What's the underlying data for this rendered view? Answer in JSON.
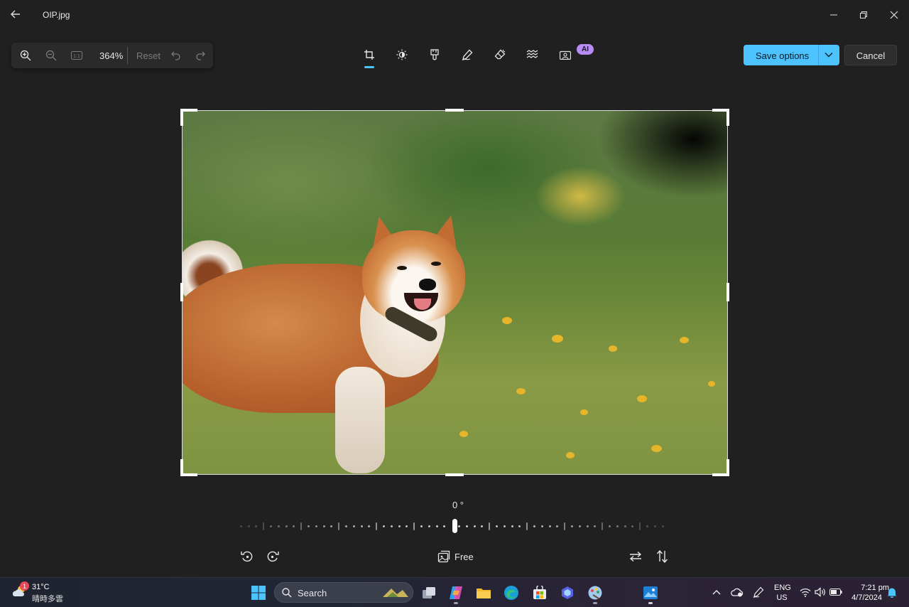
{
  "window": {
    "title": "OIP.jpg",
    "icons": {
      "back": "back-arrow-icon",
      "minimize": "minimize-icon",
      "restore": "restore-icon",
      "close": "close-icon"
    }
  },
  "zoom_toolbar": {
    "zoom_percent": "364%",
    "reset_label": "Reset",
    "icons": [
      "zoom-in-icon",
      "zoom-out-icon",
      "actual-size-icon",
      "undo-icon",
      "redo-icon"
    ]
  },
  "edit_tools": {
    "active": "crop",
    "items": [
      "crop",
      "adjustment",
      "filter",
      "markup",
      "erase",
      "blur-background",
      "remove-background"
    ],
    "ai_badge": "AI"
  },
  "actions": {
    "save_label": "Save options",
    "cancel_label": "Cancel"
  },
  "straighten": {
    "angle_label": "0 °",
    "angle_value": 0
  },
  "crop_controls": {
    "aspect_label": "Free"
  },
  "taskbar": {
    "weather": {
      "temp": "31°C",
      "desc": "晴時多雲",
      "badge": "1"
    },
    "search_placeholder": "Search",
    "apps": [
      "windows-start",
      "task-view",
      "copilot",
      "file-explorer",
      "edge",
      "microsoft-store",
      "copilot-pro",
      "paint",
      "photos"
    ],
    "language": {
      "line1": "ENG",
      "line2": "US"
    },
    "clock": {
      "time": "7:21 pm",
      "date": "4/7/2024"
    }
  },
  "colors": {
    "accent": "#4cc2ff",
    "background": "#202020",
    "ai_badge": "#b88cf6"
  }
}
